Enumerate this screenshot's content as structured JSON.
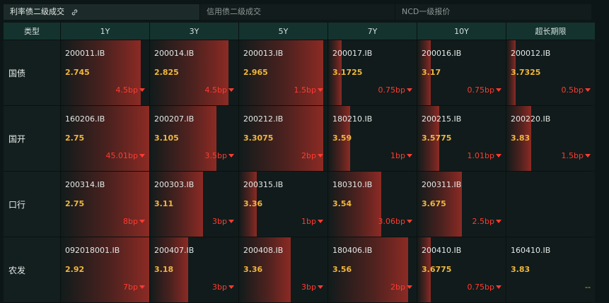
{
  "tabs": [
    {
      "label": "利率债二级成交",
      "active": true
    },
    {
      "label": "信用债二级成交",
      "active": false
    },
    {
      "label": "NCD一级报价",
      "active": false
    }
  ],
  "headers": [
    "类型",
    "1Y",
    "3Y",
    "5Y",
    "7Y",
    "10Y",
    "超长期限"
  ],
  "rows": [
    {
      "label": "国债",
      "cells": [
        {
          "code": "200011.IB",
          "yield": "2.745",
          "change": "4.5bp",
          "bar": 0.9
        },
        {
          "code": "200014.IB",
          "yield": "2.825",
          "change": "4.5bp",
          "bar": 0.89
        },
        {
          "code": "200013.IB",
          "yield": "2.965",
          "change": "1.5bp",
          "bar": 0.95
        },
        {
          "code": "200017.IB",
          "yield": "3.1725",
          "change": "0.75bp",
          "bar": 0.15
        },
        {
          "code": "200016.IB",
          "yield": "3.17",
          "change": "0.75bp",
          "bar": 0.15
        },
        {
          "code": "200012.IB",
          "yield": "3.7325",
          "change": "0.5bp",
          "bar": 0.1
        }
      ]
    },
    {
      "label": "国开",
      "cells": [
        {
          "code": "160206.IB",
          "yield": "2.75",
          "change": "45.01bp",
          "bar": 1.0
        },
        {
          "code": "200207.IB",
          "yield": "3.105",
          "change": "3.5bp",
          "bar": 0.75
        },
        {
          "code": "200212.IB",
          "yield": "3.3075",
          "change": "2bp",
          "bar": 0.95
        },
        {
          "code": "180210.IB",
          "yield": "3.59",
          "change": "1bp",
          "bar": 0.25
        },
        {
          "code": "200215.IB",
          "yield": "3.5775",
          "change": "1.01bp",
          "bar": 0.25
        },
        {
          "code": "200220.IB",
          "yield": "3.83",
          "change": "1.5bp",
          "bar": 0.28
        }
      ]
    },
    {
      "label": "口行",
      "cells": [
        {
          "code": "200314.IB",
          "yield": "2.75",
          "change": "8bp",
          "bar": 1.0
        },
        {
          "code": "200303.IB",
          "yield": "3.11",
          "change": "3bp",
          "bar": 0.6
        },
        {
          "code": "200315.IB",
          "yield": "3.36",
          "change": "1bp",
          "bar": 0.2
        },
        {
          "code": "180310.IB",
          "yield": "3.54",
          "change": "3.06bp",
          "bar": 0.6
        },
        {
          "code": "200311.IB",
          "yield": "3.675",
          "change": "2.5bp",
          "bar": 0.5
        },
        {
          "code": "",
          "yield": "",
          "change": "",
          "bar": 0
        }
      ]
    },
    {
      "label": "农发",
      "cells": [
        {
          "code": "092018001.IB",
          "yield": "2.92",
          "change": "7bp",
          "bar": 1.0
        },
        {
          "code": "200407.IB",
          "yield": "3.18",
          "change": "3bp",
          "bar": 0.43
        },
        {
          "code": "200408.IB",
          "yield": "3.36",
          "change": "3bp",
          "bar": 0.58
        },
        {
          "code": "180406.IB",
          "yield": "3.56",
          "change": "2bp",
          "bar": 0.9
        },
        {
          "code": "200410.IB",
          "yield": "3.6775",
          "change": "0.75bp",
          "bar": 0.15
        },
        {
          "code": "160410.IB",
          "yield": "3.83",
          "change": "--",
          "bar": 0
        }
      ]
    }
  ]
}
